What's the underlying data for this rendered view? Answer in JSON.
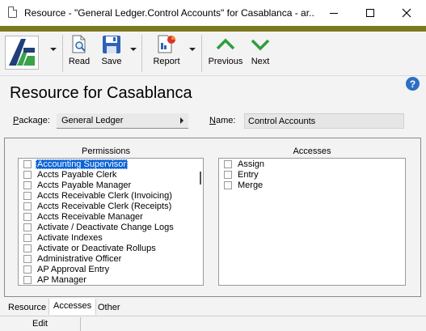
{
  "window": {
    "title": "Resource - \"General Ledger.Control Accounts\" for Casablanca - ar..."
  },
  "toolbar": {
    "read_label": "Read",
    "save_label": "Save",
    "report_label": "Report",
    "previous_label": "Previous",
    "next_label": "Next"
  },
  "header": {
    "title": "Resource for Casablanca"
  },
  "form": {
    "package_label_u": "P",
    "package_label_rest": "ackage:",
    "package_value": "General Ledger",
    "name_label_u": "N",
    "name_label_rest": "ame:",
    "name_value": "Control Accounts"
  },
  "permissions": {
    "title": "Permissions",
    "items": [
      {
        "label": "Accounting Supervisor",
        "checked": false,
        "selected": true
      },
      {
        "label": "Accts Payable Clerk",
        "checked": false
      },
      {
        "label": "Accts Payable Manager",
        "checked": false
      },
      {
        "label": "Accts Receivable Clerk (Invoicing)",
        "checked": false
      },
      {
        "label": "Accts Receivable Clerk (Receipts)",
        "checked": false
      },
      {
        "label": "Accts Receivable Manager",
        "checked": false
      },
      {
        "label": "Activate / Deactivate Change Logs",
        "checked": false
      },
      {
        "label": "Activate Indexes",
        "checked": false
      },
      {
        "label": "Activate or Deactivate Rollups",
        "checked": false
      },
      {
        "label": "Administrative Officer",
        "checked": false
      },
      {
        "label": "AP Approval Entry",
        "checked": false
      },
      {
        "label": "AP Manager",
        "checked": false
      }
    ]
  },
  "accesses": {
    "title": "Accesses",
    "items": [
      {
        "label": "Assign",
        "checked": false
      },
      {
        "label": "Entry",
        "checked": false
      },
      {
        "label": "Merge",
        "checked": false
      }
    ]
  },
  "tabs": [
    "Resource",
    "Accesses",
    "Other"
  ],
  "active_tab": "Accesses",
  "status": {
    "mode": "Edit"
  },
  "colors": {
    "accent_bar": "#7c7a1f",
    "selection": "#0a62d6",
    "arrow_green": "#2e9e3e"
  }
}
